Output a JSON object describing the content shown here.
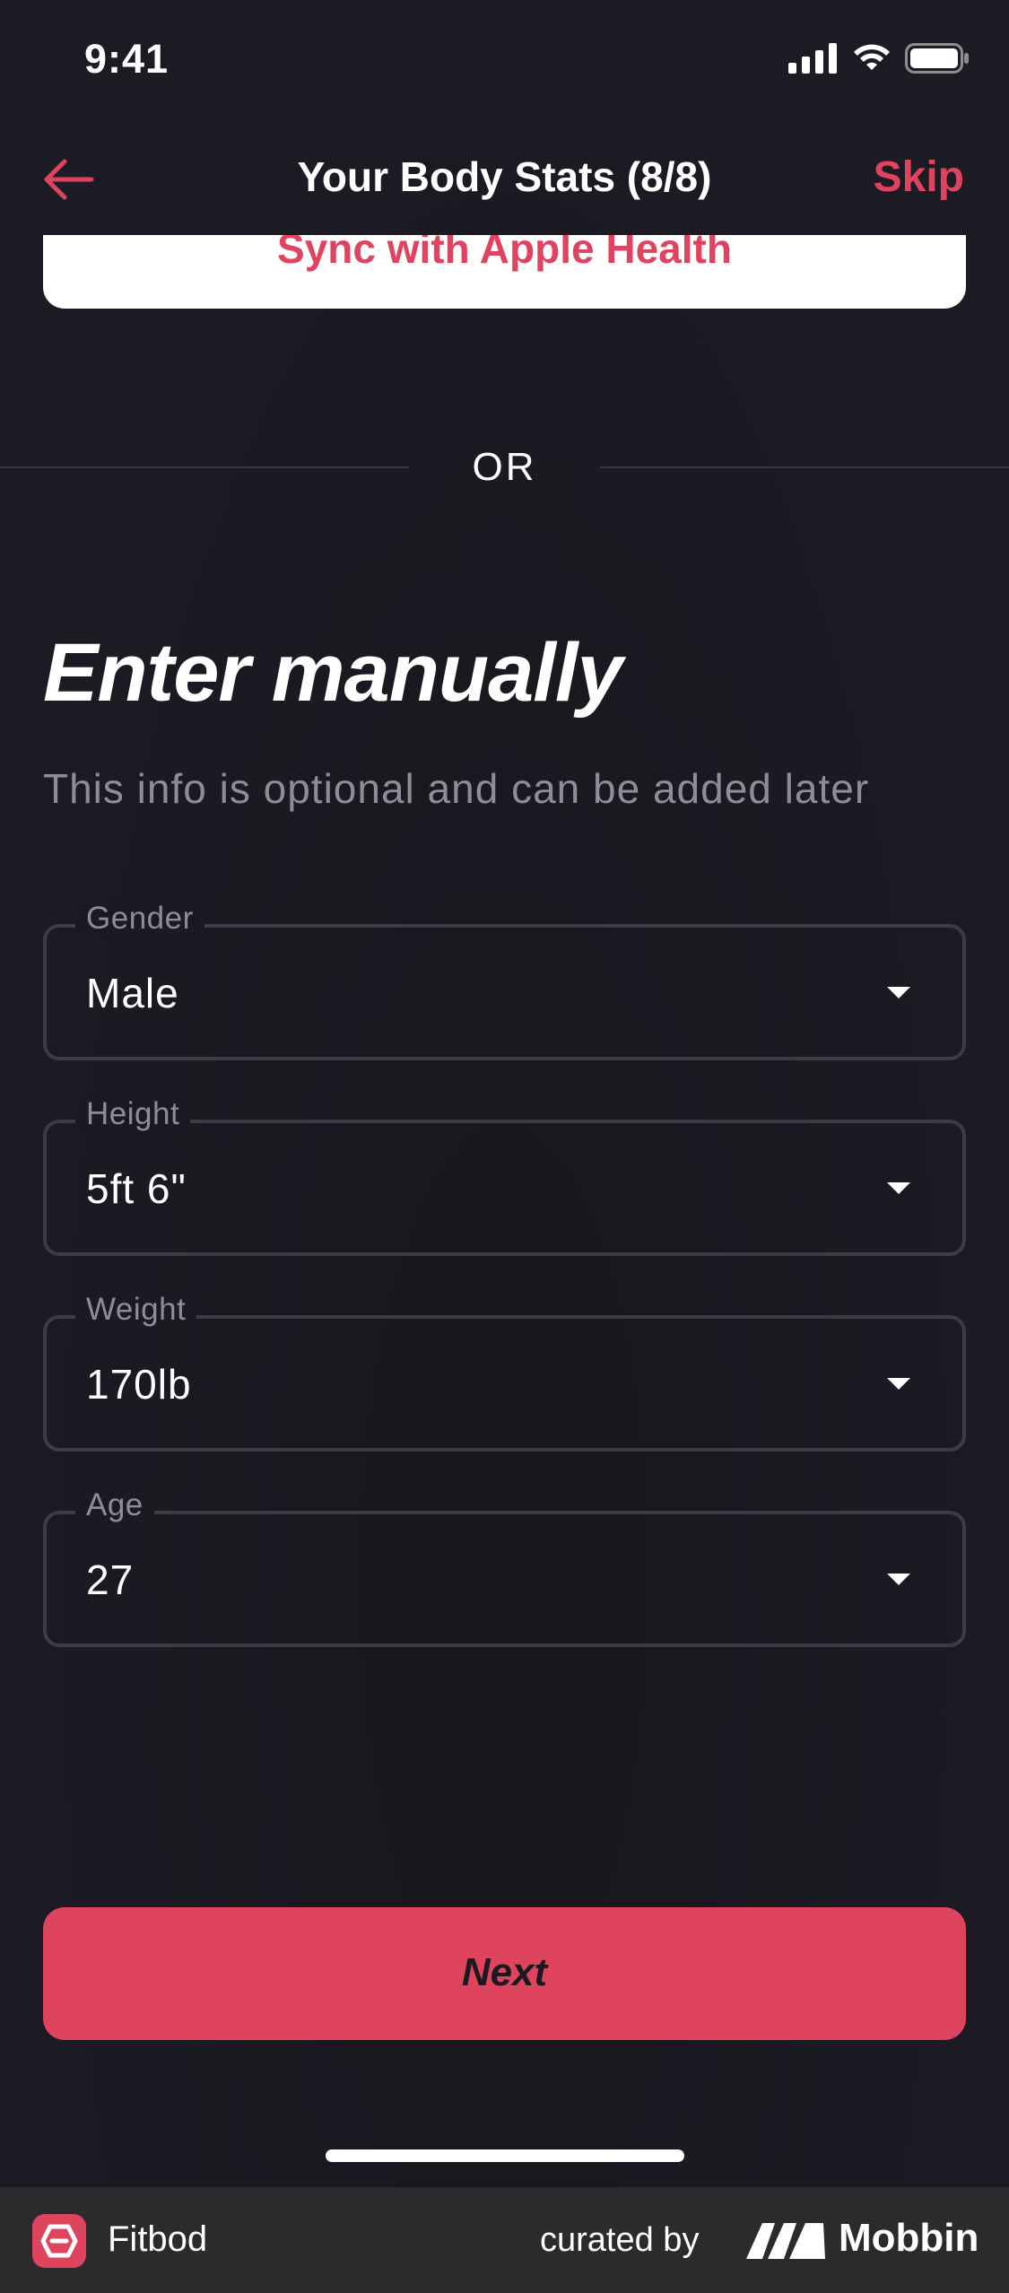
{
  "status_bar": {
    "time": "9:41"
  },
  "nav": {
    "title": "Your Body Stats (8/8)",
    "skip_label": "Skip",
    "back_icon": "arrow-left-icon"
  },
  "sync": {
    "label": "Sync with Apple Health"
  },
  "divider": {
    "label": "OR"
  },
  "manual": {
    "heading": "Enter manually",
    "subheading": "This info is optional and can be added later"
  },
  "fields": [
    {
      "label": "Gender",
      "value": "Male"
    },
    {
      "label": "Height",
      "value": "5ft 6\""
    },
    {
      "label": "Weight",
      "value": "170lb"
    },
    {
      "label": "Age",
      "value": "27"
    }
  ],
  "next_label": "Next",
  "footer": {
    "app_name": "Fitbod",
    "curated_label": "curated by",
    "brand_name": "Mobbin"
  },
  "colors": {
    "accent": "#df445e",
    "background": "#1c1b23",
    "muted_text": "#8e8c98"
  }
}
